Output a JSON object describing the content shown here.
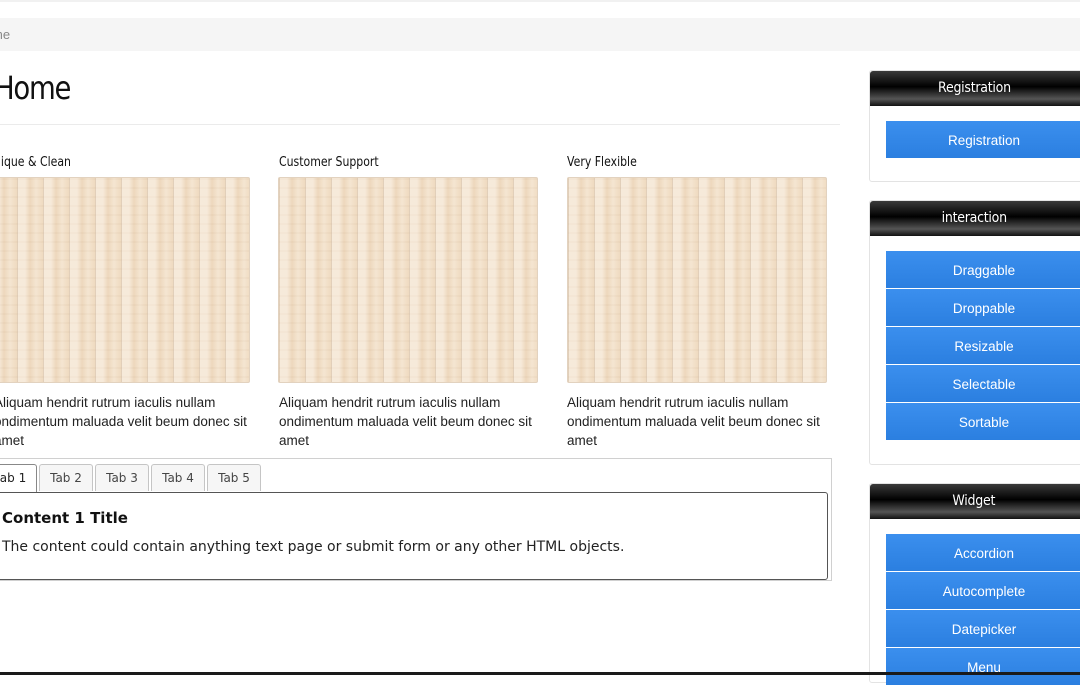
{
  "breadcrumb": {
    "text": "me"
  },
  "page": {
    "title": "Home"
  },
  "features": [
    {
      "heading": "nique & Clean",
      "text": "Aliquam hendrit rutrum iaculis nullam ondimentum maluada velit beum donec sit amet"
    },
    {
      "heading": "Customer Support",
      "text": "Aliquam hendrit rutrum iaculis nullam ondimentum maluada velit beum donec sit amet"
    },
    {
      "heading": "Very Flexible",
      "text": "Aliquam hendrit rutrum iaculis nullam ondimentum maluada velit beum donec sit amet"
    }
  ],
  "tabs": {
    "items": [
      "ab 1",
      "Tab 2",
      "Tab 3",
      "Tab 4",
      "Tab 5"
    ],
    "active": 0,
    "panel": {
      "title": "Content 1 Title",
      "text": "The content could contain anything text page or submit form or any other HTML objects."
    }
  },
  "sidebar": {
    "registration": {
      "heading": "Registration",
      "items": [
        "Registration"
      ]
    },
    "interaction": {
      "heading": "interaction",
      "items": [
        "Draggable",
        "Droppable",
        "Resizable",
        "Selectable",
        "Sortable"
      ]
    },
    "widget": {
      "heading": "Widget",
      "items": [
        "Accordion",
        "Autocomplete",
        "Datepicker",
        "Menu"
      ]
    }
  },
  "colors": {
    "button_blue": "#2f86e8",
    "header_black": "#000000"
  }
}
